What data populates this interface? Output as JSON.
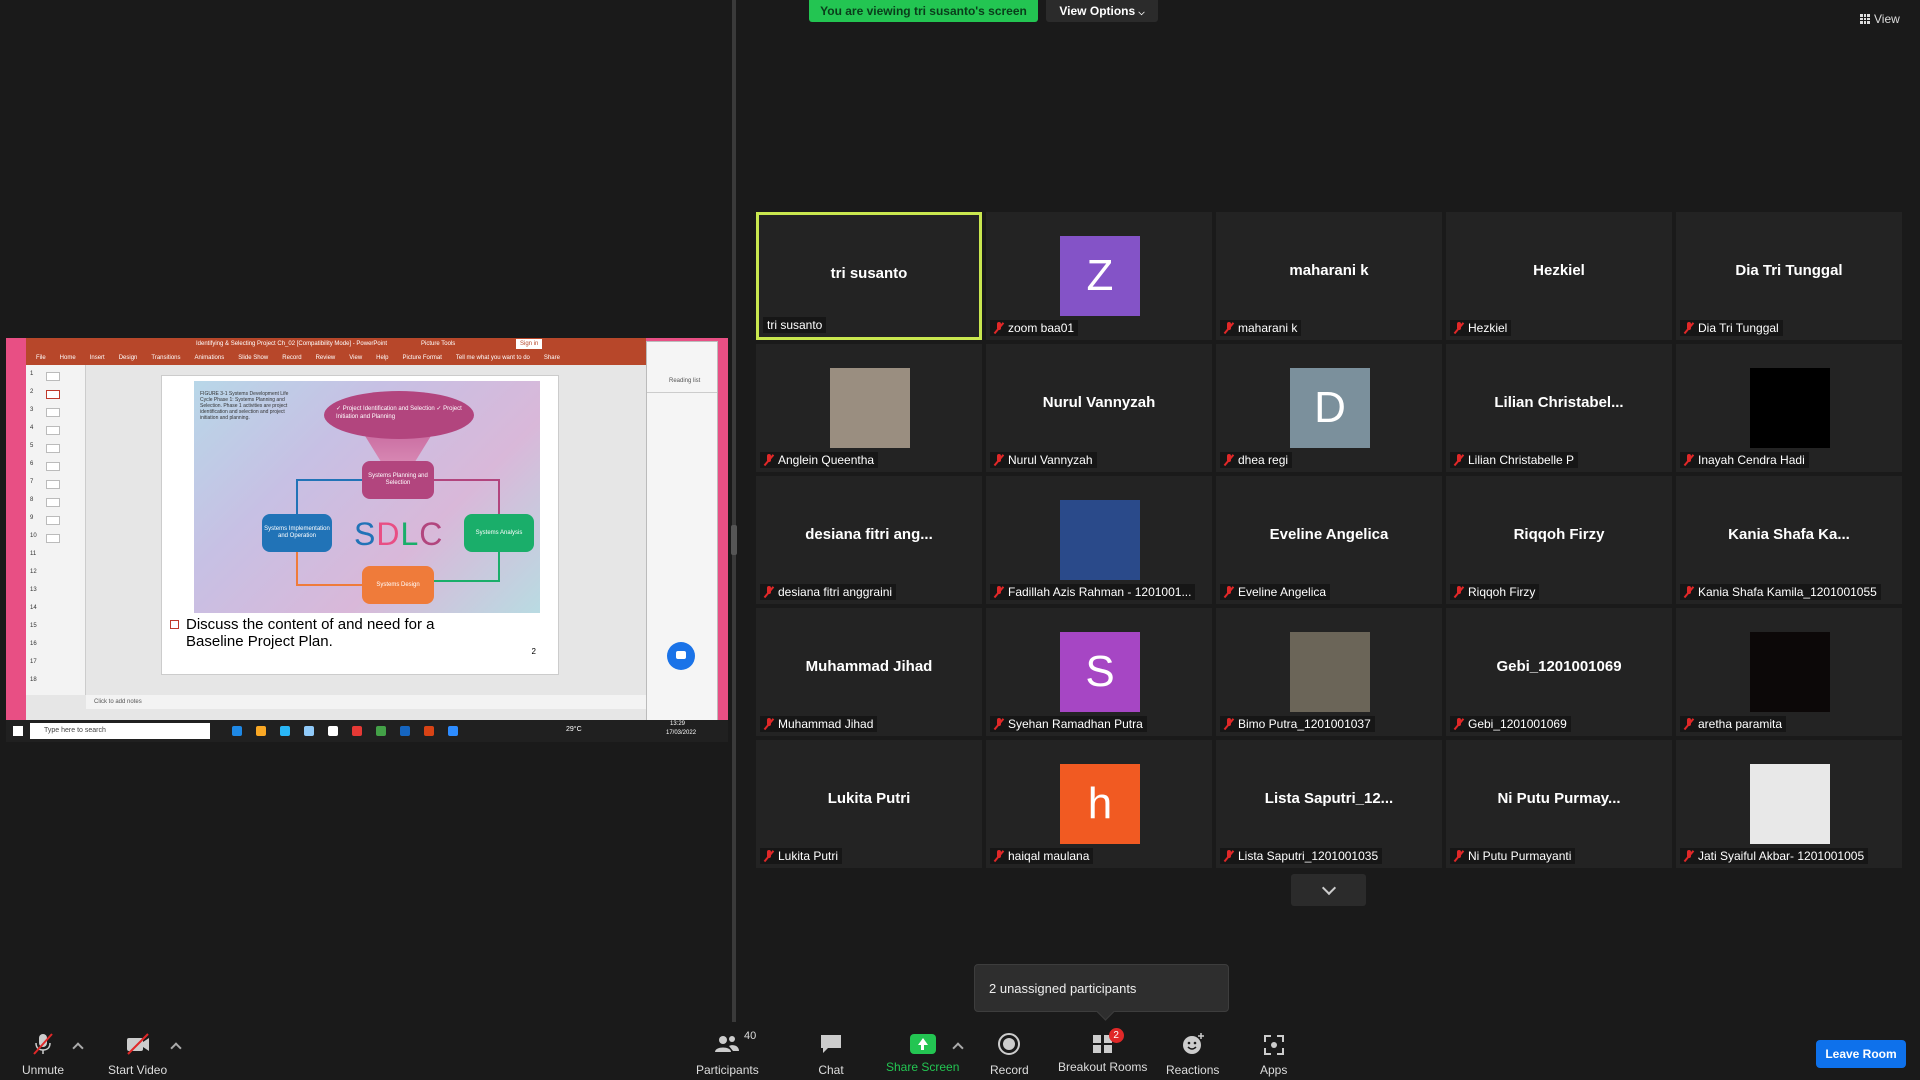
{
  "banner": {
    "viewing": "You are viewing tri susanto's screen",
    "view_options": "View Options",
    "view": "View"
  },
  "shared_screen": {
    "window_title": "Identifying & Selecting Project Ch_02 [Compatibility Mode] - PowerPoint",
    "picture_tools": "Picture Tools",
    "sign_in": "Sign in",
    "ribbon_tabs": [
      "File",
      "Home",
      "Insert",
      "Design",
      "Transitions",
      "Animations",
      "Slide Show",
      "Record",
      "Review",
      "View",
      "Help",
      "Picture Format"
    ],
    "tell_me": "Tell me what you want to do",
    "share": "Share",
    "figure_caption": "FIGURE 3-1 Systems Development Life Cycle Phase 1: Systems Planning and Selection. Phase 1 activities are project identification and selection and project initiation and planning.",
    "funnel_text": "✓ Project Identification and Selection ✓ Project Initiation and Planning",
    "box_planning": "Systems Planning and Selection",
    "box_implementation": "Systems Implementation and Operation",
    "box_analysis": "Systems Analysis",
    "box_design": "Systems Design",
    "sdlc_s": "S",
    "sdlc_d": "D",
    "sdlc_l": "L",
    "sdlc_c": "C",
    "bullet": "Discuss the content of and need for a Baseline Project Plan.",
    "page_number": "2",
    "notes": "Click to add notes",
    "slide_numbers": [
      "1",
      "2",
      "3",
      "4",
      "5",
      "6",
      "7",
      "8",
      "9",
      "10",
      "11",
      "12",
      "13",
      "14",
      "15",
      "16",
      "17",
      "18"
    ],
    "reading_list": "Reading list",
    "taskbar_search": "Type here to search",
    "weather": "29°C",
    "clock_time": "13:29",
    "clock_date": "17/03/2022"
  },
  "participants": [
    {
      "big": "tri susanto",
      "name": "tri susanto",
      "type": "name",
      "active": true,
      "muted": false
    },
    {
      "big": "Z",
      "name": "zoom baa01",
      "type": "letter",
      "color": "#8453c7",
      "muted": true
    },
    {
      "big": "maharani k",
      "name": "maharani k",
      "type": "name",
      "muted": true
    },
    {
      "big": "Hezkiel",
      "name": "Hezkiel",
      "type": "name",
      "muted": true
    },
    {
      "big": "Dia Tri Tunggal",
      "name": "Dia Tri Tunggal",
      "type": "name",
      "muted": true
    },
    {
      "big": "",
      "name": "Anglein Queentha",
      "type": "photo",
      "color": "#9a8e80",
      "muted": true
    },
    {
      "big": "Nurul Vannyzah",
      "name": "Nurul Vannyzah",
      "type": "name",
      "muted": true
    },
    {
      "big": "D",
      "name": "dhea regi",
      "type": "letter",
      "color": "#7b909c",
      "muted": true
    },
    {
      "big": "Lilian  Christabel...",
      "name": "Lilian Christabelle P",
      "type": "name",
      "muted": true
    },
    {
      "big": "",
      "name": "Inayah Cendra Hadi",
      "type": "photo",
      "color": "#000000",
      "muted": true
    },
    {
      "big": "desiana  fitri  ang...",
      "name": "desiana fitri anggraini",
      "type": "name",
      "muted": true
    },
    {
      "big": "",
      "name": "Fadillah Azis Rahman - 1201001...",
      "type": "photo",
      "color": "#2a4a8a",
      "muted": true
    },
    {
      "big": "Eveline Angelica",
      "name": "Eveline Angelica",
      "type": "name",
      "muted": true
    },
    {
      "big": "Riqqoh Firzy",
      "name": "Riqqoh Firzy",
      "type": "name",
      "muted": true
    },
    {
      "big": "Kania  Shafa  Ka...",
      "name": "Kania Shafa Kamila_1201001055",
      "type": "name",
      "muted": true
    },
    {
      "big": "Muhammad Jihad",
      "name": "Muhammad Jihad",
      "type": "name",
      "muted": true
    },
    {
      "big": "S",
      "name": "Syehan Ramadhan Putra",
      "type": "letter",
      "color": "#a646c4",
      "muted": true
    },
    {
      "big": "",
      "name": "Bimo Putra_1201001037",
      "type": "photo",
      "color": "#6b6558",
      "muted": true
    },
    {
      "big": "Gebi_1201001069",
      "name": "Gebi_1201001069",
      "type": "name",
      "muted": true
    },
    {
      "big": "",
      "name": "aretha paramita",
      "type": "photo",
      "color": "#0c0808",
      "muted": true
    },
    {
      "big": "Lukita Putri",
      "name": "Lukita Putri",
      "type": "name",
      "muted": true
    },
    {
      "big": "h",
      "name": "haiqal maulana",
      "type": "letter",
      "color": "#f15a22",
      "muted": true
    },
    {
      "big": "Lista  Saputri_12...",
      "name": "Lista Saputri_1201001035",
      "type": "name",
      "muted": true
    },
    {
      "big": "Ni  Putu  Purmay...",
      "name": "Ni Putu Purmayanti",
      "type": "name",
      "muted": true
    },
    {
      "big": "",
      "name": "Jati Syaiful Akbar- 1201001005",
      "type": "photo",
      "color": "#e8e8e8",
      "muted": true
    }
  ],
  "unassigned": "2 unassigned participants",
  "toolbar": {
    "unmute": "Unmute",
    "start_video": "Start Video",
    "participants": "Participants",
    "participants_count": "40",
    "chat": "Chat",
    "share_screen": "Share Screen",
    "record": "Record",
    "breakout_rooms": "Breakout Rooms",
    "breakout_badge": "2",
    "reactions": "Reactions",
    "apps": "Apps",
    "leave": "Leave Room"
  },
  "colors": {
    "accent_green": "#23c552",
    "active_border": "#c9e74f",
    "leave_blue": "#0e71eb",
    "mute_red": "#e02828"
  }
}
